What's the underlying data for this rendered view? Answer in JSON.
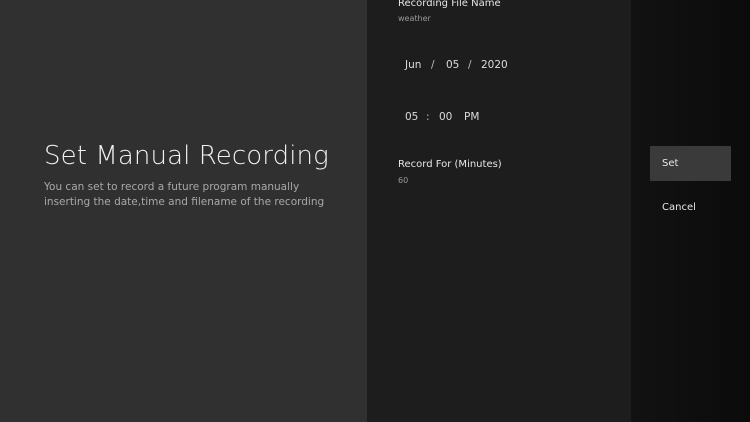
{
  "header": {
    "title": "Set Manual Recording",
    "description": "You can set to record a future program manually\ninserting the date,time and filename of the recording"
  },
  "fields": {
    "file_name": {
      "label": "Recording File Name",
      "value": "weather"
    },
    "date": {
      "month": "Jun",
      "day": "05",
      "year": "2020",
      "separator": "/"
    },
    "time": {
      "hour": "05",
      "minute": "00",
      "meridiem": "PM",
      "separator": ":"
    },
    "duration": {
      "label": "Record For (Minutes)",
      "value": "60"
    }
  },
  "actions": {
    "set_label": "Set",
    "cancel_label": "Cancel"
  },
  "colors": {
    "left_panel": "#303030",
    "middle_panel": "#1d1d1d",
    "right_panel": "#111111",
    "focus": "#3a3a3a"
  }
}
